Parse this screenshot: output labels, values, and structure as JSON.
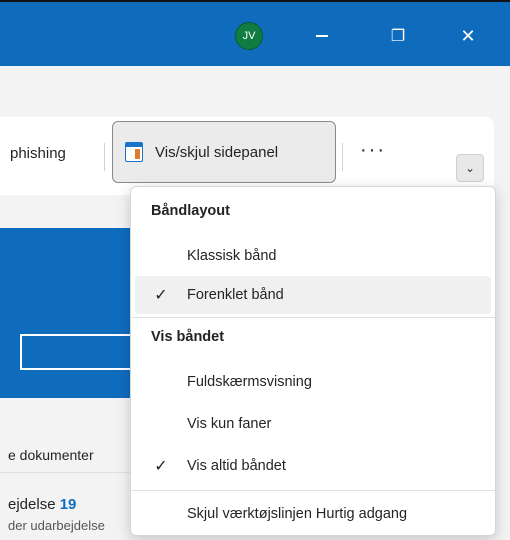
{
  "titlebar": {
    "avatar_initials": "JV",
    "minimize_glyph": "—",
    "restore_glyph": "❐",
    "close_glyph": "✕"
  },
  "ribbon": {
    "phishing_label": "phishing",
    "toggle_panel_label": "Vis/skjul sidepanel",
    "more_label": "···",
    "collapse_glyph": "⌄"
  },
  "body": {
    "documents_text": "e dokumenter",
    "task_prefix": "ejdelse ",
    "task_count": "19",
    "task_sub": "der udarbejdelse"
  },
  "dropdown": {
    "section1_title": "Båndlayout",
    "items1": [
      {
        "label": "Klassisk bånd",
        "checked": false
      },
      {
        "label": "Forenklet bånd",
        "checked": true
      }
    ],
    "section2_title": "Vis båndet",
    "items2": [
      {
        "label": "Fuldskærmsvisning",
        "checked": false
      },
      {
        "label": "Vis kun faner",
        "checked": false
      },
      {
        "label": "Vis altid båndet",
        "checked": true
      }
    ],
    "item3_label": "Skjul værktøjslinjen Hurtig adgang",
    "check_glyph": "✓"
  },
  "colors": {
    "accent": "#0f6cbd",
    "avatar_bg": "#107c41"
  }
}
